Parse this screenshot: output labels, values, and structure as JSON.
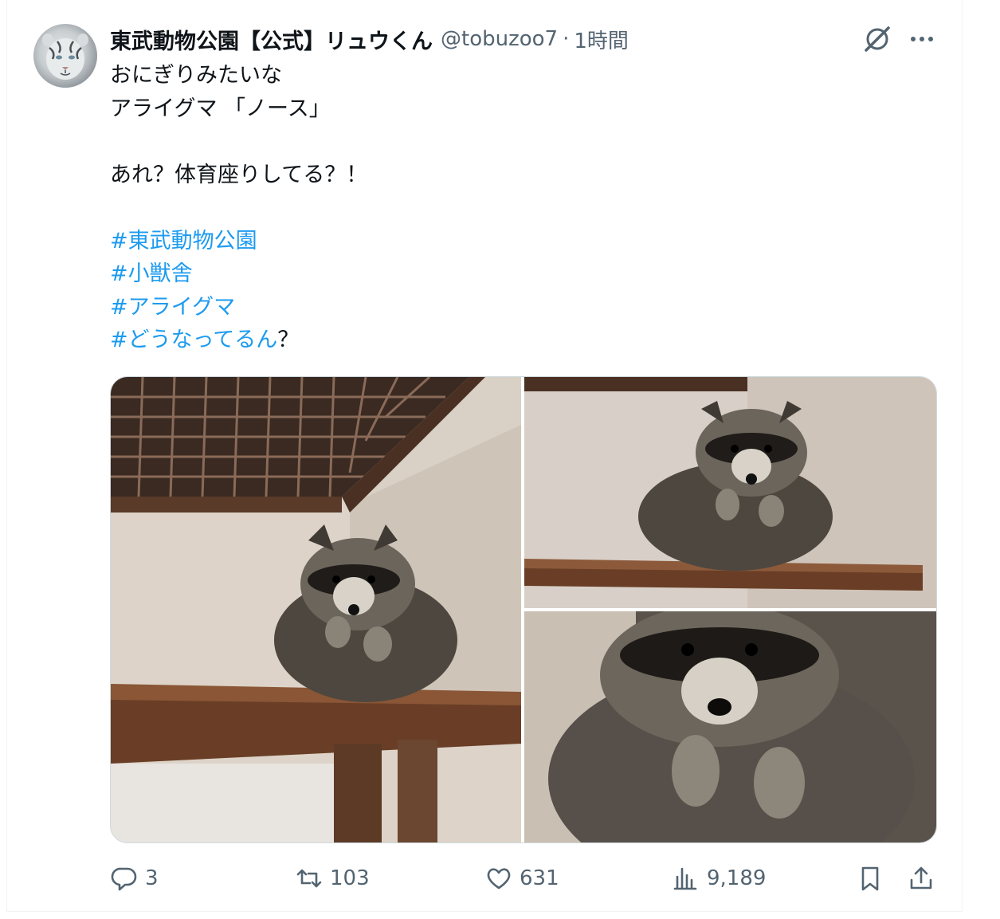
{
  "tweet": {
    "author_name": "東武動物公園【公式】リュウくん",
    "handle": "@tobuzoo7",
    "separator": "·",
    "time": "1時間",
    "text_lines": [
      "おにぎりみたいな",
      "アライグマ 「ノース」",
      "",
      "あれ？体育座りしてる？！",
      ""
    ],
    "hashtags": [
      "#東武動物公園",
      "#小獣舎",
      "#アライグマ",
      "#どうなってるん"
    ],
    "last_tag_suffix": "？"
  },
  "icons": {
    "avatar": "white-tiger-avatar",
    "grok": "grok-icon",
    "more": "more-icon",
    "reply": "reply-icon",
    "retweet": "retweet-icon",
    "like": "like-icon",
    "views": "views-icon",
    "bookmark": "bookmark-icon",
    "share": "share-icon"
  },
  "media": [
    {
      "alt": "raccoon on wooden shelf under grate"
    },
    {
      "alt": "raccoon sitting on shelf"
    },
    {
      "alt": "raccoon close-up"
    }
  ],
  "actions": {
    "replies": "3",
    "retweets": "103",
    "likes": "631",
    "views": "9,189"
  },
  "colors": {
    "link": "#1d9bf0",
    "secondary": "#536471",
    "text": "#0f1419"
  }
}
